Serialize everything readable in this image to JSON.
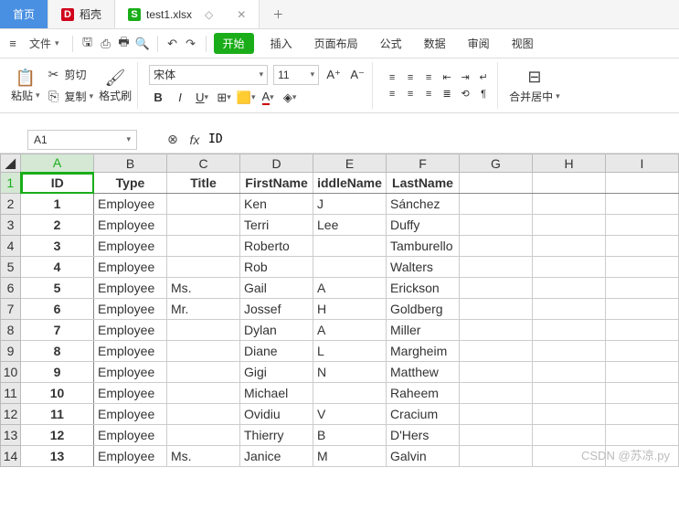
{
  "tabs": {
    "home": "首页",
    "daoke": "稻壳",
    "file": "test1.xlsx"
  },
  "menu": {
    "file": "文件",
    "start": "开始",
    "insert": "插入",
    "layout": "页面布局",
    "formula": "公式",
    "data": "数据",
    "review": "审阅",
    "view": "视图"
  },
  "ribbon": {
    "paste": "粘贴",
    "cut": "剪切",
    "copy": "复制",
    "format_painter": "格式刷",
    "font": "宋体",
    "size": "11",
    "merge": "合并居中"
  },
  "namebox": "A1",
  "formula": "ID",
  "columns": [
    "A",
    "B",
    "C",
    "D",
    "E",
    "F",
    "G",
    "H",
    "I"
  ],
  "headers": [
    "ID",
    "Type",
    "Title",
    "FirstName",
    "iddleName",
    "LastName",
    "",
    "",
    ""
  ],
  "rows": [
    [
      "1",
      "Employee",
      "",
      "Ken",
      "J",
      "Sánchez",
      "",
      "",
      ""
    ],
    [
      "2",
      "Employee",
      "",
      "Terri",
      "Lee",
      "Duffy",
      "",
      "",
      ""
    ],
    [
      "3",
      "Employee",
      "",
      "Roberto",
      "",
      "Tamburello",
      "",
      "",
      ""
    ],
    [
      "4",
      "Employee",
      "",
      "Rob",
      "",
      "Walters",
      "",
      "",
      ""
    ],
    [
      "5",
      "Employee",
      "Ms.",
      "Gail",
      "A",
      "Erickson",
      "",
      "",
      ""
    ],
    [
      "6",
      "Employee",
      "Mr.",
      "Jossef",
      "H",
      "Goldberg",
      "",
      "",
      ""
    ],
    [
      "7",
      "Employee",
      "",
      "Dylan",
      "A",
      "Miller",
      "",
      "",
      ""
    ],
    [
      "8",
      "Employee",
      "",
      "Diane",
      "L",
      "Margheim",
      "",
      "",
      ""
    ],
    [
      "9",
      "Employee",
      "",
      "Gigi",
      "N",
      "Matthew",
      "",
      "",
      ""
    ],
    [
      "10",
      "Employee",
      "",
      "Michael",
      "",
      "Raheem",
      "",
      "",
      ""
    ],
    [
      "11",
      "Employee",
      "",
      "Ovidiu",
      "V",
      "Cracium",
      "",
      "",
      ""
    ],
    [
      "12",
      "Employee",
      "",
      "Thierry",
      "B",
      "D'Hers",
      "",
      "",
      ""
    ],
    [
      "13",
      "Employee",
      "Ms.",
      "Janice",
      "M",
      "Galvin",
      "",
      "",
      ""
    ]
  ],
  "watermark": "CSDN @苏凉.py"
}
